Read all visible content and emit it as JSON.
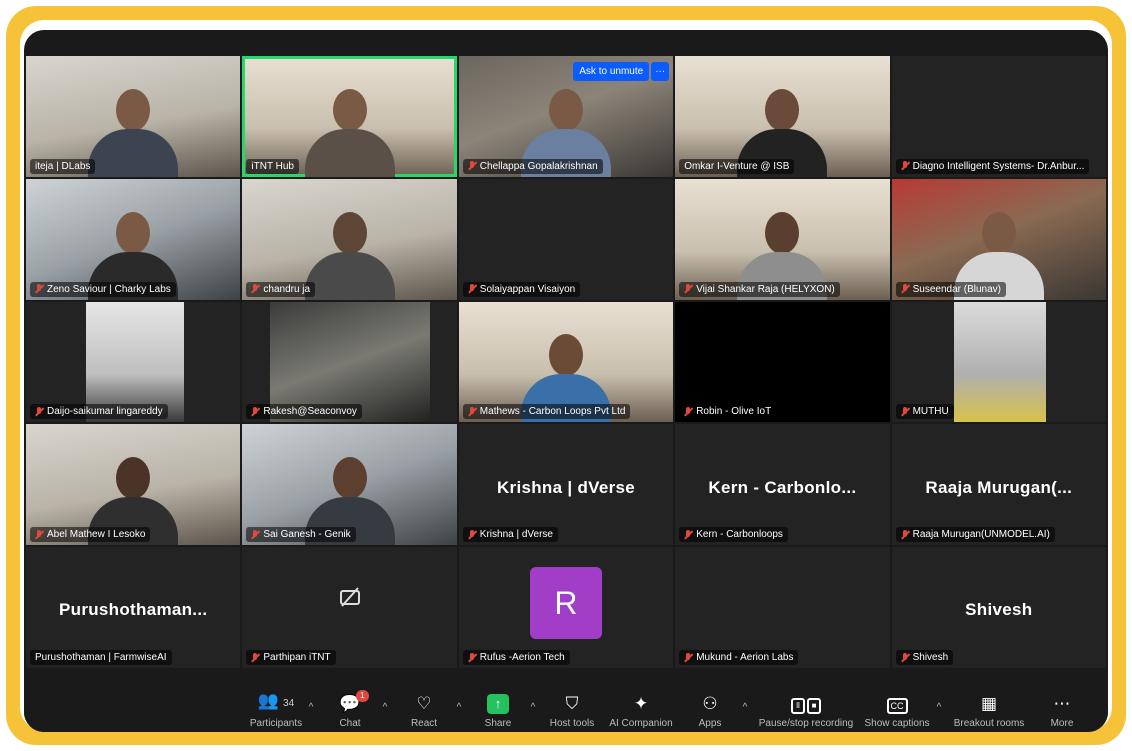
{
  "tiles": [
    {
      "name": "iteja | DLabs",
      "muted": false
    },
    {
      "name": "iTNT Hub",
      "muted": false
    },
    {
      "name": "Chellappa Gopalakrishnan",
      "muted": true
    },
    {
      "name": "Omkar I-Venture @ ISB",
      "muted": false
    },
    {
      "name": "Diagno Intelligent Systems- Dr.Anbur...",
      "muted": true
    },
    {
      "name": "Zeno Saviour | Charky Labs",
      "muted": true
    },
    {
      "name": "chandru ja",
      "muted": true
    },
    {
      "name": "Solaiyappan Visaiyon",
      "muted": true
    },
    {
      "name": "Vijai Shankar Raja (HELYXON)",
      "muted": true
    },
    {
      "name": "Suseendar (Blunav)",
      "muted": true
    },
    {
      "name": "Daijo-saikumar lingareddy",
      "muted": true
    },
    {
      "name": "Rakesh@Seaconvoy",
      "muted": true
    },
    {
      "name": "Mathews - Carbon Loops Pvt Ltd",
      "muted": true
    },
    {
      "name": "Robin - Olive IoT",
      "muted": true
    },
    {
      "name": "MUTHU",
      "muted": true
    },
    {
      "name": "Abel Mathew I Lesoko",
      "muted": true
    },
    {
      "name": "Sai Ganesh - Genik",
      "muted": true
    },
    {
      "name": "Krishna | dVerse",
      "muted": true,
      "display": "Krishna | dVerse"
    },
    {
      "name": "Kern - Carbonloops",
      "muted": true,
      "display": "Kern - Carbonlo..."
    },
    {
      "name": "Raaja Murugan(UNMODEL.AI)",
      "muted": true,
      "display": "Raaja Murugan(..."
    },
    {
      "name": "Purushothaman | FarmwiseAI",
      "muted": false,
      "display": "Purushothaman..."
    },
    {
      "name": "Parthipan iTNT",
      "muted": true
    },
    {
      "name": "Rufus -Aerion Tech",
      "muted": true,
      "avatar": "R"
    },
    {
      "name": "Mukund - Aerion Labs",
      "muted": true
    },
    {
      "name": "Shivesh",
      "muted": true,
      "display": "Shivesh"
    }
  ],
  "unmute": {
    "label": "Ask to unmute",
    "more": "···"
  },
  "toolbar": {
    "participants": {
      "label": "Participants",
      "count": "34"
    },
    "chat": {
      "label": "Chat",
      "badge": "1"
    },
    "react": {
      "label": "React"
    },
    "share": {
      "label": "Share"
    },
    "host_tools": {
      "label": "Host tools"
    },
    "ai_companion": {
      "label": "AI Companion"
    },
    "apps": {
      "label": "Apps"
    },
    "recording": {
      "label": "Pause/stop recording"
    },
    "captions": {
      "label": "Show captions"
    },
    "breakout": {
      "label": "Breakout rooms"
    },
    "more": {
      "label": "More"
    }
  },
  "colors": {
    "frame": "#f6c338",
    "active": "#23d96b",
    "avatar": "#a23dc8",
    "share": "#25c15c",
    "unmute": "#0b5cff"
  }
}
